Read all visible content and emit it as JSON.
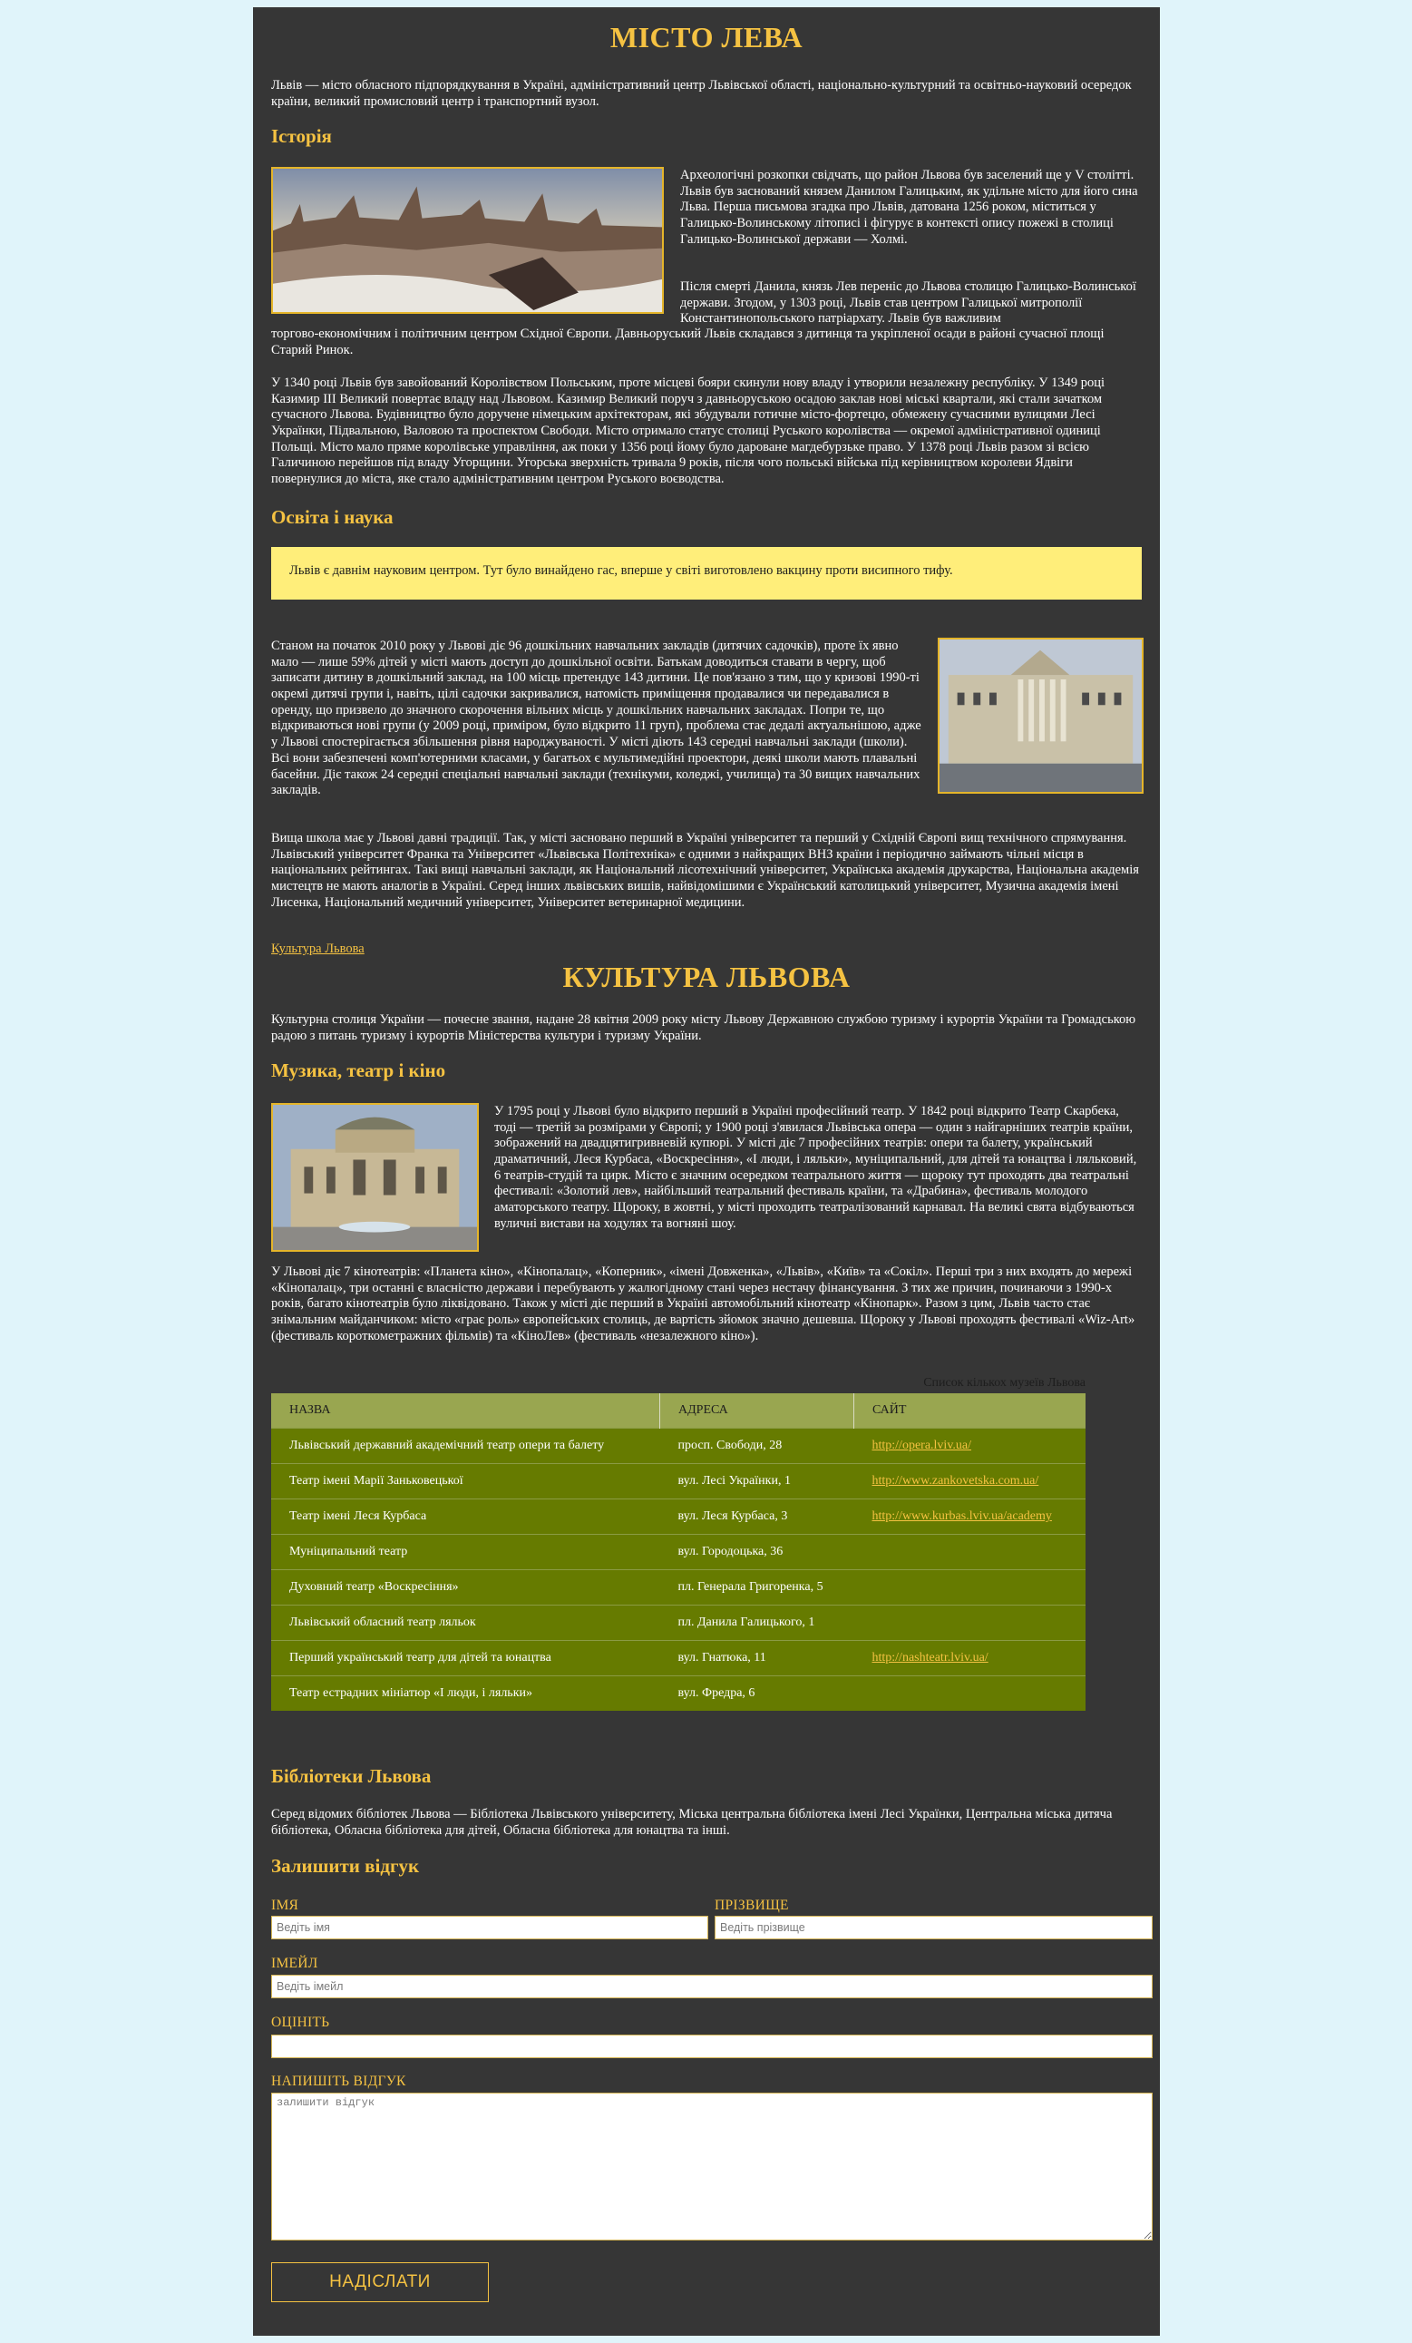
{
  "header": {
    "title": "МІСТО ЛЕВА",
    "intro": "Львів — місто обласного підпорядкування в Україні, адміністративний центр Львівської області, національно-культурний та освітньо-науковий осередок країни, великий промисловий центр і транспортний вузол."
  },
  "history": {
    "heading": "Історія",
    "p1": "Археологічні розкопки свідчать, що район Львова був заселений ще у V столітті. Львів був заснований князем Данилом Галицьким, як удільне місто для його сина Льва. Перша письмова згадка про Львів, датована 1256 роком, міститься у Галицько-Волинському літописі і фігурує в контексті опису пожежі в столиці Галицько-Волинської держави — Холмі.",
    "p2": "Після смерті Данила, князь Лев переніс до Львова столицю Галицько-Волинської держави. Згодом, у 1303 році, Львів став центром Галицької митрополії Константинопольського патріархату. Львів був важливим торгово-економічним і політичним центром Східної Європи. Давньоруський Львів складався з дитинця та укріпленої осади в районі сучасної площі Старий Ринок.",
    "p3": "У 1340 році Львів був завойований Королівством Польським, проте місцеві бояри скинули нову владу і утворили незалежну республіку. У 1349 році Казимир III Великий повертає владу над Львовом. Казимир Великий поруч з давньоруською осадою заклав нові міські квартали, які стали зачатком сучасного Львова. Будівництво було доручене німецьким архітекторам, які збудували готичне місто-фортецю, обмежену сучасними вулицями Лесі Українки, Підвальною, Валовою та проспектом Свободи. Місто отримало статус столиці Руського королівства — окремої адміністративної одиниці Польщі. Місто мало пряме королівське управління, аж поки у 1356 році йому було дароване магдебурзьке право. У 1378 році Львів разом зі всією Галичиною перейшов під владу Угорщини. Угорська зверхність тривала 9 років, після чого польські війська під керівництвом королеви Ядвіги повернулися до міста, яке стало адміністративним центром Руського воєводства."
  },
  "education": {
    "heading": "Освіта і наука",
    "callout": "Львів є давнім науковим центром. Тут було винайдено гас, вперше у світі виготовлено вакцину проти висипного тифу.",
    "p1": "Станом на початок 2010 року у Львові діє 96 дошкільних навчальних закладів (дитячих садочків), проте їх явно мало — лише 59% дітей у місті мають доступ до дошкільної освіти. Батькам доводиться ставати в чергу, щоб записати дитину в дошкільний заклад, на 100 місць претендує 143 дитини. Це пов'язано з тим, що у кризові 1990-ті окремі дитячі групи і, навіть, цілі садочки закривалися, натомість приміщення продавалися чи передавалися в оренду, що призвело до значного скорочення вільних місць у дошкільних навчальних закладах. Попри те, що відкриваються нові групи (у 2009 році, приміром, було відкрито 11 груп), проблема стає дедалі актуальнішою, адже у Львові спостерігається збільшення рівня народжуваності. У місті діють 143 середні навчальні заклади (школи). Всі вони забезпечені комп'ютерними класами, у багатьох є мультимедійні проектори, деякі школи мають плавальні басейни. Діє також 24 середні спеціальні навчальні заклади (технікуми, коледжі, училища) та 30 вищих навчальних закладів.",
    "p2": "Вища школа має у Львові давні традиції. Так, у місті засновано перший в Україні університет та перший у Східній Європі вищ технічного спрямування. Львівський університет Франка та Університет «Львівська Політехніка» є одними з найкращих ВНЗ країни і періодично займають чільні місця в національних рейтингах. Такі вищі навчальні заклади, як Національний лісотехнічний університет, Українська академія друкарства, Національна академія мистецтв не мають аналогів в Україні. Серед інших львівських вишів, найвідомішими є Український католицький університет, Музична академія імені Лисенка, Національний медичний університет, Університет ветеринарної медицини.",
    "link": "Культура Львова"
  },
  "culture": {
    "title": "КУЛЬТУРА ЛЬВОВА",
    "intro": "Культурна столиця України — почесне звання, надане 28 квітня 2009 року місту Львову Державною службою туризму і курортів України та Громадською радою з питань туризму і курортів Міністерства культури і туризму України.",
    "music_heading": "Музика, театр і кіно",
    "m1": "У 1795 році у Львові було відкрито перший в Україні професійний театр. У 1842 році відкрито Театр Скарбека, тоді — третій за розмірами у Європі; у 1900 році з'явилася Львівська опера — один з найгарніших театрів країни, зображений на двадцятигривневій купюрі. У місті діє 7 професійних театрів: опери та балету, український драматичний, Леся Курбаса, «Воскресіння», «І люди, і ляльки», муніципальний, для дітей та юнацтва і ляльковий, 6 театрів-студій та цирк. Місто є значним осередком театрального життя — щороку тут проходять два театральні фестивалі: «Золотий лев», найбільший театральний фестиваль країни, та «Драбина», фестиваль молодого аматорського театру. Щороку, в жовтні, у місті проходить театралізований карнавал. На великі свята відбуваються вуличні вистави на ходулях та вогняні шоу.",
    "m2": "У Львові діє 7 кінотеатрів: «Планета кіно», «Кінопалац», «Коперник», «імені Довженка», «Львів», «Київ» та «Сокіл». Перші три з них входять до мережі «Кінопалац», три останні є власністю держави і перебувають у жалюгідному стані через нестачу фінансування. З тих же причин, починаючи з 1990-х років, багато кінотеатрів було ліквідовано. Також у місті діє перший в Україні автомобільний кінотеатр «Кінопарк». Разом з цим, Львів часто стає знімальним майданчиком: місто «грає роль» європейських столиць, де вартість зйомок значно дешевша. Щороку у Львові проходять фестивалі «Wiz-Art» (фестиваль короткометражних фільмів) та «КіноЛев» (фестиваль «незалежного кіно»)."
  },
  "theatre_table": {
    "caption": "Список кількох музеїв Львова",
    "headers": [
      "НАЗВА",
      "АДРЕСА",
      "САЙТ"
    ],
    "rows": [
      {
        "name": "Львівський державний академічний театр опери та балету",
        "address": "просп. Свободи, 28",
        "site": "http://opera.lviv.ua/"
      },
      {
        "name": "Театр імені Марії Заньковецької",
        "address": "вул. Лесі Українки, 1",
        "site": "http://www.zankovetska.com.ua/"
      },
      {
        "name": "Театр імені Леся Курбаса",
        "address": "вул. Леся Курбаса, 3",
        "site": "http://www.kurbas.lviv.ua/academy"
      },
      {
        "name": "Муніципальний театр",
        "address": "вул. Городоцька, 36",
        "site": ""
      },
      {
        "name": "Духовний театр «Воскресіння»",
        "address": "пл. Генерала Григоренка, 5",
        "site": ""
      },
      {
        "name": "Львівський обласний театр ляльок",
        "address": "пл. Данила Галицького, 1",
        "site": ""
      },
      {
        "name": "Перший український театр для дітей та юнацтва",
        "address": "вул. Гнатюка, 11",
        "site": "http://nashteatr.lviv.ua/"
      },
      {
        "name": "Театр естрадних мініатюр «І люди, і ляльки»",
        "address": "вул. Фредра, 6",
        "site": ""
      }
    ]
  },
  "libraries": {
    "heading": "Бібліотеки Львова",
    "text": "Серед відомих бібліотек Львова — Бібліотека Львівського університету, Міська центральна бібліотека імені Лесі Українки, Центральна міська дитяча бібліотека, Обласна бібліотека для дітей, Обласна бібліотека для юнацтва та інші."
  },
  "form": {
    "heading": "Залишити відгук",
    "first_name_label": "ІМЯ",
    "first_name_placeholder": "Ведіть імя",
    "last_name_label": "ПРІЗВИЩЕ",
    "last_name_placeholder": "Ведіть прізвище",
    "email_label": "ІМЕЙЛ",
    "email_placeholder": "Ведіть імейл",
    "rating_label": "ОЦІНІТЬ",
    "review_label": "НАПИШІТЬ ВІДГУК",
    "review_placeholder": "залишити відгук",
    "submit_label": "НАДІСЛАТИ"
  },
  "colors": {
    "page_bg": "#e0f4fa",
    "content_bg": "#363636",
    "accent": "#f5c242",
    "callout_bg": "#ffee7a",
    "table_header": "#99a650",
    "table_row": "#667b00"
  },
  "images": {
    "panorama": "panorama-painting-image",
    "university": "university-building-image",
    "opera": "opera-house-image"
  }
}
